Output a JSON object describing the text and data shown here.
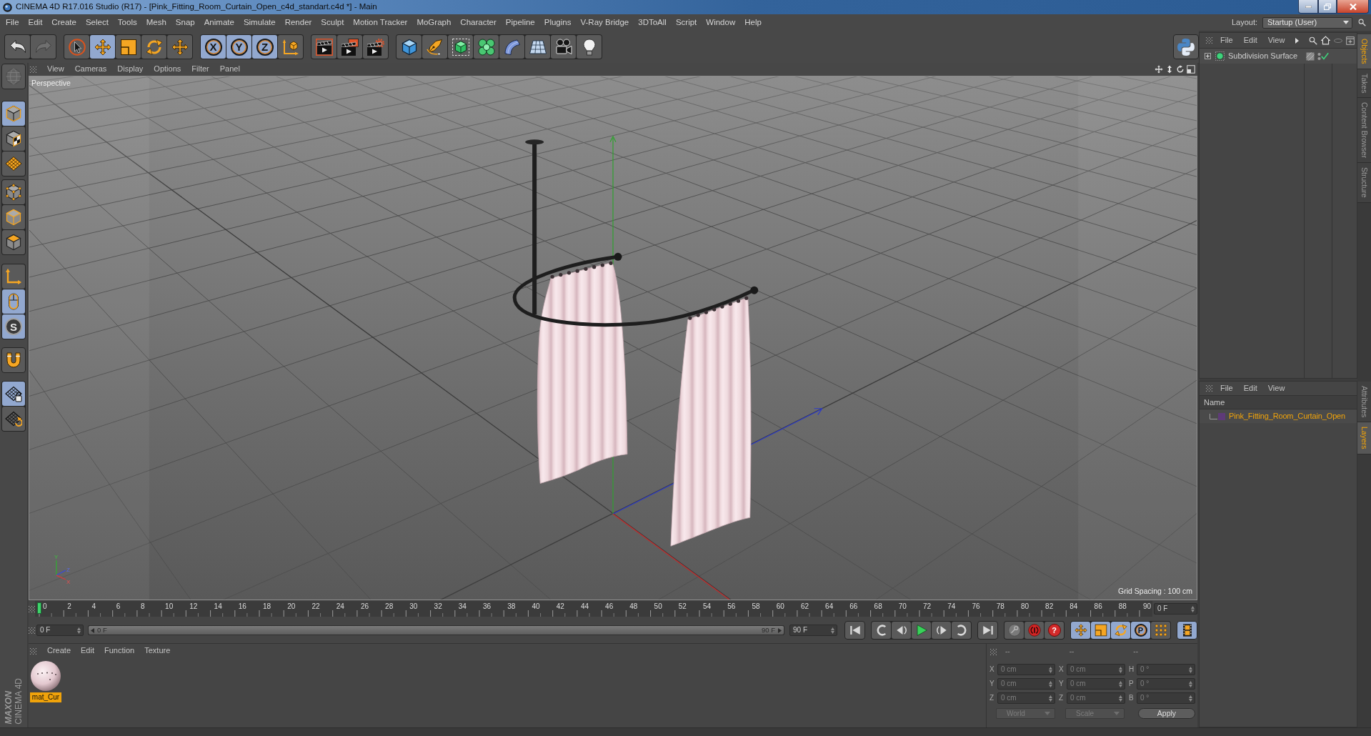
{
  "window": {
    "title": "CINEMA 4D R17.016 Studio (R17) - [Pink_Fitting_Room_Curtain_Open_c4d_standart.c4d *] - Main"
  },
  "menu_bar": {
    "items": [
      "File",
      "Edit",
      "Create",
      "Select",
      "Tools",
      "Mesh",
      "Snap",
      "Animate",
      "Simulate",
      "Render",
      "Sculpt",
      "Motion Tracker",
      "MoGraph",
      "Character",
      "Pipeline",
      "Plugins",
      "V-Ray Bridge",
      "3DToAll",
      "Script",
      "Window",
      "Help"
    ],
    "layout_label": "Layout:",
    "layout_value": "Startup (User)"
  },
  "toolbar": {
    "history": [
      {
        "kind": "undo",
        "disabled": false
      },
      {
        "kind": "redo",
        "disabled": true
      }
    ],
    "tools": [
      {
        "kind": "live-select",
        "selected": false
      },
      {
        "kind": "move",
        "selected": true
      },
      {
        "kind": "scale",
        "selected": false
      },
      {
        "kind": "rotate",
        "selected": false
      },
      {
        "kind": "recent",
        "selected": false
      }
    ],
    "axes": [
      {
        "kind": "axis",
        "label": "X",
        "selected": true
      },
      {
        "kind": "axis",
        "label": "Y",
        "selected": true
      },
      {
        "kind": "axis",
        "label": "Z",
        "selected": true
      },
      {
        "kind": "coord-system",
        "selected": false
      }
    ],
    "render": [
      {
        "kind": "render-view"
      },
      {
        "kind": "render-picture"
      },
      {
        "kind": "render-settings"
      }
    ],
    "create": [
      {
        "kind": "cube"
      },
      {
        "kind": "pen"
      },
      {
        "kind": "subdivision"
      },
      {
        "kind": "cloner"
      },
      {
        "kind": "deformer"
      },
      {
        "kind": "floor"
      },
      {
        "kind": "camera"
      },
      {
        "kind": "light"
      }
    ],
    "script": [
      {
        "kind": "python"
      }
    ]
  },
  "left_toolbar": {
    "top": [
      {
        "kind": "make-editable",
        "disabled": true
      }
    ],
    "modes": [
      {
        "kind": "model",
        "selected": true
      },
      {
        "kind": "texture",
        "selected": false
      },
      {
        "kind": "workplane",
        "selected": false
      }
    ],
    "components": [
      {
        "kind": "points",
        "selected": false
      },
      {
        "kind": "edges",
        "selected": false
      },
      {
        "kind": "polygons",
        "selected": false
      }
    ],
    "extras": [
      {
        "kind": "axis-mode",
        "selected": false
      },
      {
        "kind": "tweak",
        "selected": true
      },
      {
        "kind": "solo",
        "label": "S",
        "selected": true
      }
    ],
    "snap": [
      {
        "kind": "magnet",
        "selected": false
      }
    ],
    "grid": [
      {
        "kind": "grid-lock",
        "selected": true
      },
      {
        "kind": "grid-rotate",
        "selected": false
      }
    ],
    "logo": {
      "brand": "MAXON",
      "product": "CINEMA 4D"
    }
  },
  "viewport": {
    "menu": [
      "View",
      "Cameras",
      "Display",
      "Options",
      "Filter",
      "Panel"
    ],
    "camera": "Perspective",
    "grid_spacing": "Grid Spacing : 100 cm",
    "gizmo_labels": [
      "Y",
      "Z",
      "X"
    ]
  },
  "timeline": {
    "ticks": [
      "0",
      "2",
      "4",
      "6",
      "8",
      "10",
      "12",
      "14",
      "16",
      "18",
      "20",
      "22",
      "24",
      "26",
      "28",
      "30",
      "32",
      "34",
      "36",
      "38",
      "40",
      "42",
      "44",
      "46",
      "48",
      "50",
      "52",
      "54",
      "56",
      "58",
      "60",
      "62",
      "64",
      "66",
      "68",
      "70",
      "72",
      "74",
      "76",
      "78",
      "80",
      "82",
      "84",
      "86",
      "88",
      "90"
    ],
    "level": 0,
    "current_frame": "0 F"
  },
  "transport": {
    "start_field": "0 F",
    "range": {
      "start": "0 F",
      "end": "90 F",
      "level": 1
    },
    "end_field": "90 F",
    "playback": [
      {
        "kind": "first"
      },
      {
        "kind": "prev-key"
      },
      {
        "kind": "prev-frame"
      },
      {
        "kind": "play"
      },
      {
        "kind": "next-frame"
      },
      {
        "kind": "next-key"
      },
      {
        "kind": "last"
      }
    ],
    "record": [
      {
        "kind": "keyframe"
      },
      {
        "kind": "record"
      },
      {
        "kind": "autokey",
        "label": "?"
      }
    ],
    "keys": [
      {
        "kind": "move",
        "selected": true
      },
      {
        "kind": "scale",
        "selected": true
      },
      {
        "kind": "rotate",
        "selected": true
      },
      {
        "kind": "param",
        "label": "P",
        "selected": true
      },
      {
        "kind": "point-level",
        "selected": false
      }
    ],
    "timeline_button": [
      {
        "kind": "film",
        "selected": true
      }
    ]
  },
  "materials": {
    "menu": [
      "Create",
      "Edit",
      "Function",
      "Texture"
    ],
    "items": [
      {
        "name": "mat_Cur",
        "selected": true
      }
    ]
  },
  "coordinates": {
    "headers": [
      "--",
      "--",
      "--"
    ],
    "rows": [
      {
        "axis": "X",
        "position": "0 cm",
        "size_axis": "X",
        "size": "0 cm",
        "rotation_axis": "H",
        "rotation": "0 °"
      },
      {
        "axis": "Y",
        "position": "0 cm",
        "size_axis": "Y",
        "size": "0 cm",
        "rotation_axis": "P",
        "rotation": "0 °"
      },
      {
        "axis": "Z",
        "position": "0 cm",
        "size_axis": "Z",
        "size": "0 cm",
        "rotation_axis": "B",
        "rotation": "0 °"
      }
    ],
    "coord_mode": "World",
    "size_mode": "Scale",
    "apply": "Apply"
  },
  "objects": {
    "menu": [
      "File",
      "Edit",
      "View"
    ],
    "items": [
      {
        "name": "Subdivision Surface",
        "expanded": false,
        "enabled": true,
        "selected": false
      }
    ]
  },
  "layers": {
    "menu": [
      "File",
      "Edit",
      "View"
    ],
    "column": "Name",
    "items": [
      {
        "name": "Pink_Fitting_Room_Curtain_Open",
        "color": "#5e3a78",
        "selected": true
      }
    ]
  },
  "side_tabs": {
    "upper": [
      {
        "label": "Objects",
        "selected": true
      },
      {
        "label": "Takes",
        "selected": false
      },
      {
        "label": "Content Browser",
        "selected": false
      },
      {
        "label": "Structure",
        "selected": false
      }
    ],
    "lower": [
      {
        "label": "Attributes",
        "selected": false
      },
      {
        "label": "Layers",
        "selected": true
      }
    ]
  }
}
